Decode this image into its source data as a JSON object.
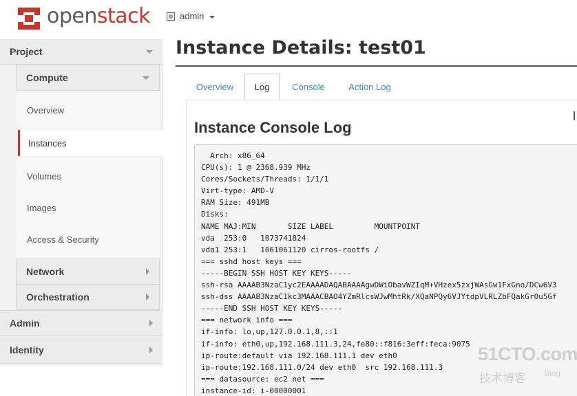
{
  "brand": {
    "open": "open",
    "stack": "stack",
    "accent": "#c0392b"
  },
  "header": {
    "project_label": "admin"
  },
  "sidebar": {
    "project": "Project",
    "compute": "Compute",
    "compute_items": [
      "Overview",
      "Instances",
      "Volumes",
      "Images",
      "Access & Security"
    ],
    "active_item": "Instances",
    "network": "Network",
    "orchestration": "Orchestration",
    "admin": "Admin",
    "identity": "Identity"
  },
  "main": {
    "title": "Instance Details: test01",
    "tabs": [
      "Overview",
      "Log",
      "Console",
      "Action Log"
    ],
    "active_tab": "Log",
    "section_title": "Instance Console Log",
    "log_lines": [
      "  Arch: x86_64",
      "CPU(s): 1 @ 2368.939 MHz",
      "Cores/Sockets/Threads: 1/1/1",
      "Virt-type: AMD-V",
      "RAM Size: 491MB",
      "Disks:",
      "NAME MAJ:MIN       SIZE LABEL         MOUNTPOINT",
      "vda  253:0   1073741824",
      "vda1 253:1   1061061120 cirros-rootfs /",
      "=== sshd host keys ===",
      "-----BEGIN SSH HOST KEY KEYS-----",
      "ssh-rsa AAAAB3NzaC1yc2EAAAADAQABAAAAgwDWiObavWZIqM+VHzex5zxjWAsGw1FxGno/DCw6V3",
      "ssh-dss AAAAB3NzaC1kc3MAAACBAO4YZmRlcsWJwMhtRk/XQaNPQy6VJYtdpVLRLZbFQakGr0u5Gf",
      "-----END SSH HOST KEY KEYS-----",
      "=== network info ===",
      "if-info: lo,up,127.0.0.1,8,::1",
      "if-info: eth0,up,192.168.111.3,24,fe80::f816:3eff:feca:9075",
      "ip-route:default via 192.168.111.1 dev eth0",
      "ip-route:192.168.111.0/24 dev eth0  src 192.168.111.3",
      "=== datasource: ec2 net ===",
      "instance-id: i-00000001"
    ]
  },
  "watermark": {
    "big": "51CTO.com",
    "small": "技术博客",
    "blog": "Blog"
  }
}
